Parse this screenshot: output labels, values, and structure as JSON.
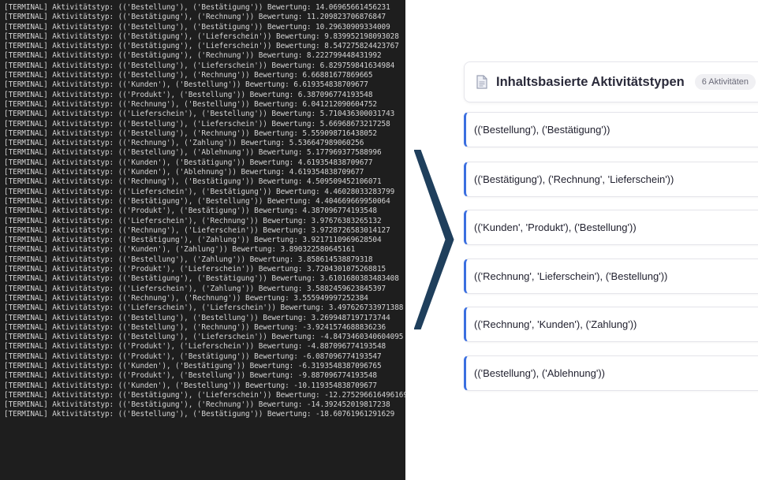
{
  "terminal": {
    "lines": [
      "[TERMINAL] Aktivitätstyp: (('Bestellung'), ('Bestätigung')) Bewertung: 14.06965661456231",
      "[TERMINAL] Aktivitätstyp: (('Bestätigung'), ('Rechnung')) Bewertung: 11.209823706876847",
      "[TERMINAL] Aktivitätstyp: (('Bestellung'), ('Bestätigung')) Bewertung: 10.29630909334009",
      "[TERMINAL] Aktivitätstyp: (('Bestätigung'), ('Lieferschein')) Bewertung: 9.839952198093028",
      "[TERMINAL] Aktivitätstyp: (('Bestätigung'), ('Lieferschein')) Bewertung: 8.547275824423767",
      "[TERMINAL] Aktivitätstyp: (('Bestätigung'), ('Rechnung')) Bewertung: 8.222799448431992",
      "[TERMINAL] Aktivitätstyp: (('Bestellung'), ('Lieferschein')) Bewertung: 6.829759841634984",
      "[TERMINAL] Aktivitätstyp: (('Bestellung'), ('Rechnung')) Bewertung: 6.66881677869665",
      "[TERMINAL] Aktivitätstyp: (('Kunden'), ('Bestellung')) Bewertung: 6.619354838709677",
      "[TERMINAL] Aktivitätstyp: (('Produkt'), ('Bestellung')) Bewertung: 6.387096774193548",
      "[TERMINAL] Aktivitätstyp: (('Rechnung'), ('Bestellung')) Bewertung: 6.041212090604752",
      "[TERMINAL] Aktivitätstyp: (('Lieferschein'), ('Bestellung')) Bewertung: 5.710436300031743",
      "[TERMINAL] Aktivitätstyp: (('Bestellung'), ('Lieferschein')) Bewertung: 5.66968673217258",
      "[TERMINAL] Aktivitätstyp: (('Bestellung'), ('Rechnung')) Bewertung: 5.559098716438052",
      "[TERMINAL] Aktivitätstyp: (('Rechnung'), ('Zahlung')) Bewertung: 5.536647989060256",
      "[TERMINAL] Aktivitätstyp: (('Bestellung'), ('Ablehnung')) Bewertung: 5.177969377588996",
      "[TERMINAL] Aktivitätstyp: (('Kunden'), ('Bestätigung')) Bewertung: 4.619354838709677",
      "[TERMINAL] Aktivitätstyp: (('Kunden'), ('Ablehnung')) Bewertung: 4.619354838709677",
      "[TERMINAL] Aktivitätstyp: (('Rechnung'), ('Bestätigung')) Bewertung: 4.509509452106071",
      "[TERMINAL] Aktivitätstyp: (('Lieferschein'), ('Bestätigung')) Bewertung: 4.46028033283799",
      "[TERMINAL] Aktivitätstyp: (('Bestätigung'), ('Bestellung')) Bewertung: 4.404669669950064",
      "[TERMINAL] Aktivitätstyp: (('Produkt'), ('Bestätigung')) Bewertung: 4.387096774193548",
      "[TERMINAL] Aktivitätstyp: (('Lieferschein'), ('Rechnung')) Bewertung: 3.97676383265132",
      "[TERMINAL] Aktivitätstyp: (('Rechnung'), ('Lieferschein')) Bewertung: 3.9728726583014127",
      "[TERMINAL] Aktivitätstyp: (('Bestätigung'), ('Zahlung')) Bewertung: 3.9217110969628504",
      "[TERMINAL] Aktivitätstyp: (('Kunden'), ('Zahlung')) Bewertung: 3.890322580645161",
      "[TERMINAL] Aktivitätstyp: (('Bestellung'), ('Zahlung')) Bewertung: 3.858614538879318",
      "[TERMINAL] Aktivitätstyp: (('Produkt'), ('Lieferschein')) Bewertung: 3.7204301075268815",
      "[TERMINAL] Aktivitätstyp: (('Bestätigung'), ('Bestätigung')) Bewertung: 3.6101680383483408",
      "[TERMINAL] Aktivitätstyp: (('Lieferschein'), ('Zahlung')) Bewertung: 3.5882459623845397",
      "[TERMINAL] Aktivitätstyp: (('Rechnung'), ('Rechnung')) Bewertung: 3.555949997252384",
      "[TERMINAL] Aktivitätstyp: (('Lieferschein'), ('Lieferschein')) Bewertung: 3.497626733971388",
      "[TERMINAL] Aktivitätstyp: (('Bestellung'), ('Bestellung')) Bewertung: 3.2699487197173744",
      "[TERMINAL] Aktivitätstyp: (('Bestellung'), ('Rechnung')) Bewertung: -3.9241574688836236",
      "[TERMINAL] Aktivitätstyp: (('Bestellung'), ('Lieferschein')) Bewertung: -4.8473460340604095",
      "[TERMINAL] Aktivitätstyp: (('Produkt'), ('Lieferschein')) Bewertung: -4.887096774193548",
      "[TERMINAL] Aktivitätstyp: (('Produkt'), ('Bestätigung')) Bewertung: -6.087096774193547",
      "[TERMINAL] Aktivitätstyp: (('Kunden'), ('Bestätigung')) Bewertung: -6.3193548387096765",
      "[TERMINAL] Aktivitätstyp: (('Produkt'), ('Bestellung')) Bewertung: -9.887096774193548",
      "[TERMINAL] Aktivitätstyp: (('Kunden'), ('Bestellung')) Bewertung: -10.119354838709677",
      "[TERMINAL] Aktivitätstyp: (('Bestätigung'), ('Lieferschein')) Bewertung: -12.275296616496169",
      "[TERMINAL] Aktivitätstyp: (('Bestätigung'), ('Rechnung')) Bewertung: -14.392452019817238",
      "[TERMINAL] Aktivitätstyp: (('Bestellung'), ('Bestätigung')) Bewertung: -18.60761961291629"
    ]
  },
  "arrow": {
    "color": "#1f3f5c",
    "icon": "chevron-right-arrow"
  },
  "panel": {
    "icon": "document-icon",
    "title": "Inhaltsbasierte Aktivitätstypen",
    "badge": "6 Aktivitäten"
  },
  "cards": [
    {
      "label": "(('Bestellung'), ('Bestätigung'))"
    },
    {
      "label": "(('Bestätigung'), ('Rechnung', 'Lieferschein'))"
    },
    {
      "label": "(('Kunden', 'Produkt'), ('Bestellung'))"
    },
    {
      "label": "(('Rechnung', 'Lieferschein'), ('Bestellung'))"
    },
    {
      "label": "(('Rechnung', 'Kunden'), ('Zahlung'))"
    },
    {
      "label": "(('Bestellung'), ('Ablehnung'))"
    }
  ],
  "colors": {
    "accent": "#3b6fe0",
    "terminal_bg": "#1e1e1e",
    "terminal_text": "#d4d4d4"
  }
}
